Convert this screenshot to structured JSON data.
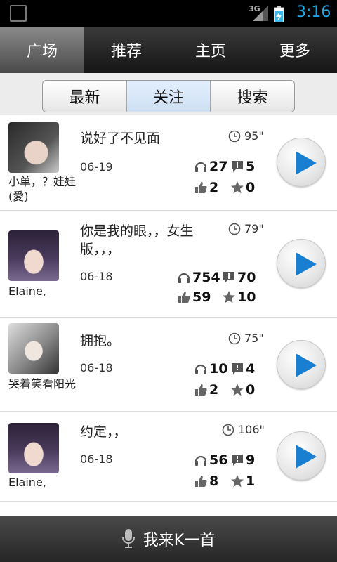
{
  "status_bar": {
    "network": "3G",
    "time": "3:16"
  },
  "top_nav": {
    "tabs": [
      {
        "label": "广场",
        "active": true
      },
      {
        "label": "推荐",
        "active": false
      },
      {
        "label": "主页",
        "active": false
      },
      {
        "label": "更多",
        "active": false
      }
    ]
  },
  "segment": {
    "options": [
      {
        "label": "最新",
        "active": false
      },
      {
        "label": "关注",
        "active": true
      },
      {
        "label": "搜索",
        "active": false
      }
    ]
  },
  "feed": [
    {
      "user": "小单，？娃娃(愛)",
      "title": "说好了不见面",
      "duration": "95\"",
      "date": "06-19",
      "plays": "27",
      "comments": "5",
      "likes": "2",
      "favorites": "0"
    },
    {
      "user": "Elaine,",
      "title": "你是我的眼，，女生版，，，",
      "duration": "79\"",
      "date": "06-18",
      "plays": "754",
      "comments": "70",
      "likes": "59",
      "favorites": "10"
    },
    {
      "user": "哭着笑看阳光",
      "title": "拥抱。",
      "duration": "75\"",
      "date": "06-18",
      "plays": "10",
      "comments": "4",
      "likes": "2",
      "favorites": "0"
    },
    {
      "user": "Elaine,",
      "title": "约定，，",
      "duration": "106\"",
      "date": "06-18",
      "plays": "56",
      "comments": "9",
      "likes": "8",
      "favorites": "1"
    }
  ],
  "bottom_bar": {
    "label": "我来K一首",
    "icon": "microphone-icon"
  },
  "colors": {
    "accent_blue": "#1a7fd0",
    "status_time": "#1ba7e8"
  }
}
